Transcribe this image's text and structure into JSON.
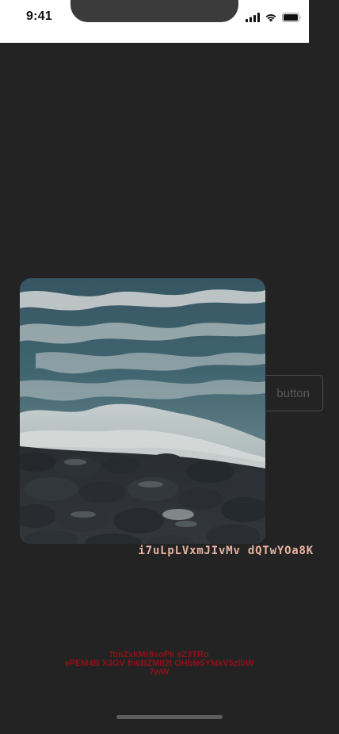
{
  "status_bar": {
    "time": "9:41",
    "icons": [
      "cellular-signal-icon",
      "wifi-icon",
      "battery-icon"
    ]
  },
  "ghost_button": {
    "label": "button"
  },
  "photo": {
    "description_icon": "sea-waves-rocks-photo"
  },
  "caption": {
    "text": "i7uLpLVxmJIvMv dQTwYOa8K"
  },
  "red_text": {
    "line1": "ftmZxkMr8soPk sZ3TRo",
    "line2": "ePEM4B X3GV fn6BZMll2t OHble5YMkV5zlbW",
    "line3": "7wW"
  },
  "colors": {
    "background": "#232323",
    "status_bar": "#ffffff",
    "caption": "#e6b3a3",
    "red_text": "#8e1118"
  }
}
